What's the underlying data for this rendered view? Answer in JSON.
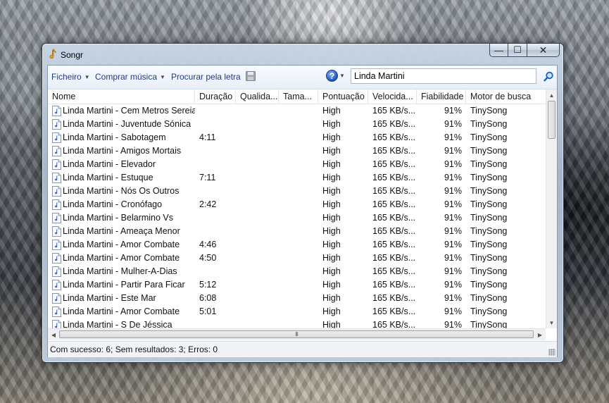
{
  "window": {
    "title": "Songr",
    "app_icon": "music-note-icon",
    "buttons": {
      "minimize": "—",
      "maximize": "☐",
      "close": "✕"
    }
  },
  "toolbar": {
    "menus": [
      {
        "label": "Ficheiro"
      },
      {
        "label": "Comprar música"
      },
      {
        "label": "Procurar pela letra"
      }
    ],
    "save_icon": "floppy-disk-icon",
    "help_icon": "help-icon",
    "help_glyph": "?",
    "search_value": "Linda Martini",
    "search_icon": "magnifier-icon"
  },
  "columns": [
    "Nome",
    "Duração",
    "Qualida...",
    "Tama...",
    "Pontuação",
    "Velocida...",
    "Fiabilidade",
    "Motor de busca"
  ],
  "rows": [
    {
      "name": "Linda Martini - Cem Metros Sereia",
      "duration": "",
      "quality": "",
      "size": "",
      "score": "High",
      "speed": "165 KB/s...",
      "reliability": "91%",
      "engine": "TinySong"
    },
    {
      "name": "Linda Martini - Juventude Sónica",
      "duration": "",
      "quality": "",
      "size": "",
      "score": "High",
      "speed": "165 KB/s...",
      "reliability": "91%",
      "engine": "TinySong"
    },
    {
      "name": "Linda Martini - Sabotagem",
      "duration": "4:11",
      "quality": "",
      "size": "",
      "score": "High",
      "speed": "165 KB/s...",
      "reliability": "91%",
      "engine": "TinySong"
    },
    {
      "name": "Linda Martini - Amigos Mortais",
      "duration": "",
      "quality": "",
      "size": "",
      "score": "High",
      "speed": "165 KB/s...",
      "reliability": "91%",
      "engine": "TinySong"
    },
    {
      "name": "Linda Martini - Elevador",
      "duration": "",
      "quality": "",
      "size": "",
      "score": "High",
      "speed": "165 KB/s...",
      "reliability": "91%",
      "engine": "TinySong"
    },
    {
      "name": "Linda Martini - Estuque",
      "duration": "7:11",
      "quality": "",
      "size": "",
      "score": "High",
      "speed": "165 KB/s...",
      "reliability": "91%",
      "engine": "TinySong"
    },
    {
      "name": "Linda Martini - Nós Os Outros",
      "duration": "",
      "quality": "",
      "size": "",
      "score": "High",
      "speed": "165 KB/s...",
      "reliability": "91%",
      "engine": "TinySong"
    },
    {
      "name": "Linda Martini - Cronófago",
      "duration": "2:42",
      "quality": "",
      "size": "",
      "score": "High",
      "speed": "165 KB/s...",
      "reliability": "91%",
      "engine": "TinySong"
    },
    {
      "name": "Linda Martini - Belarmino Vs",
      "duration": "",
      "quality": "",
      "size": "",
      "score": "High",
      "speed": "165 KB/s...",
      "reliability": "91%",
      "engine": "TinySong"
    },
    {
      "name": "Linda Martini - Ameaça Menor",
      "duration": "",
      "quality": "",
      "size": "",
      "score": "High",
      "speed": "165 KB/s...",
      "reliability": "91%",
      "engine": "TinySong"
    },
    {
      "name": "Linda Martini - Amor Combate",
      "duration": "4:46",
      "quality": "",
      "size": "",
      "score": "High",
      "speed": "165 KB/s...",
      "reliability": "91%",
      "engine": "TinySong"
    },
    {
      "name": "Linda Martini - Amor Combate",
      "duration": "4:50",
      "quality": "",
      "size": "",
      "score": "High",
      "speed": "165 KB/s...",
      "reliability": "91%",
      "engine": "TinySong"
    },
    {
      "name": "Linda Martini - Mulher-A-Dias",
      "duration": "",
      "quality": "",
      "size": "",
      "score": "High",
      "speed": "165 KB/s...",
      "reliability": "91%",
      "engine": "TinySong"
    },
    {
      "name": "Linda Martini - Partir Para Ficar",
      "duration": "5:12",
      "quality": "",
      "size": "",
      "score": "High",
      "speed": "165 KB/s...",
      "reliability": "91%",
      "engine": "TinySong"
    },
    {
      "name": "Linda Martini - Este Mar",
      "duration": "6:08",
      "quality": "",
      "size": "",
      "score": "High",
      "speed": "165 KB/s...",
      "reliability": "91%",
      "engine": "TinySong"
    },
    {
      "name": "Linda Martini - Amor Combate",
      "duration": "5:01",
      "quality": "",
      "size": "",
      "score": "High",
      "speed": "165 KB/s...",
      "reliability": "91%",
      "engine": "TinySong"
    },
    {
      "name": "Linda Martini - S De Jéssica",
      "duration": "",
      "quality": "",
      "size": "",
      "score": "High",
      "speed": "165 KB/s...",
      "reliability": "91%",
      "engine": "TinySong"
    }
  ],
  "scrollbar": {
    "grip": "III"
  },
  "status": {
    "text": "Com sucesso: 6; Sem resultados: 3; Erros: 0"
  },
  "colors": {
    "menu_text": "#1e3a8a",
    "title_glass": "#b9c9dc",
    "help_blue": "#1e56b8"
  }
}
